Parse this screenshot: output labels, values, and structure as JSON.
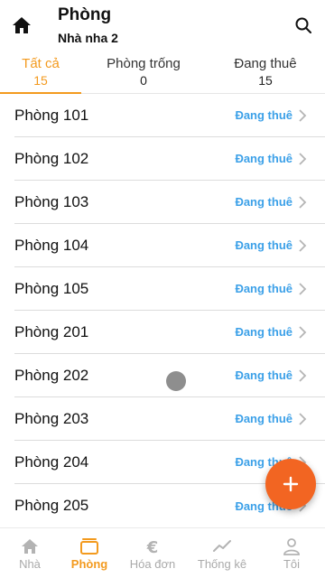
{
  "header": {
    "title": "Phòng",
    "subtitle": "Nhà nha 2"
  },
  "tabs": [
    {
      "label": "Tất cả",
      "count": "15",
      "active": true
    },
    {
      "label": "Phòng trống",
      "count": "0",
      "active": false
    },
    {
      "label": "Đang thuê",
      "count": "15",
      "active": false
    }
  ],
  "rooms": [
    {
      "name": "Phòng 101",
      "status": "Đang thuê"
    },
    {
      "name": "Phòng 102",
      "status": "Đang thuê"
    },
    {
      "name": "Phòng 103",
      "status": "Đang thuê"
    },
    {
      "name": "Phòng 104",
      "status": "Đang thuê"
    },
    {
      "name": "Phòng 105",
      "status": "Đang thuê"
    },
    {
      "name": "Phòng 201",
      "status": "Đang thuê"
    },
    {
      "name": "Phòng 202",
      "status": "Đang thuê"
    },
    {
      "name": "Phòng 203",
      "status": "Đang thuê"
    },
    {
      "name": "Phòng 204",
      "status": "Đang thuê"
    },
    {
      "name": "Phòng 205",
      "status": "Đang thuê"
    }
  ],
  "fab": {
    "icon": "plus-icon"
  },
  "bottom_nav": [
    {
      "label": "Nhà",
      "icon": "home-icon",
      "active": false
    },
    {
      "label": "Phòng",
      "icon": "room-icon",
      "active": true
    },
    {
      "label": "Hóa đơn",
      "icon": "euro-icon",
      "active": false
    },
    {
      "label": "Thống kê",
      "icon": "chart-icon",
      "active": false
    },
    {
      "label": "Tôi",
      "icon": "user-icon",
      "active": false
    }
  ],
  "colors": {
    "accent": "#f39a1e",
    "status": "#3ba0e8",
    "fab": "#f26522",
    "inactive": "#aaaaaa"
  }
}
